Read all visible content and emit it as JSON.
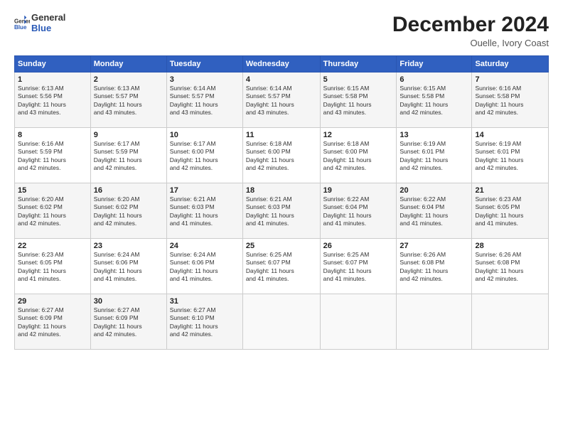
{
  "logo": {
    "line1": "General",
    "line2": "Blue"
  },
  "title": "December 2024",
  "subtitle": "Ouelle, Ivory Coast",
  "days_of_week": [
    "Sunday",
    "Monday",
    "Tuesday",
    "Wednesday",
    "Thursday",
    "Friday",
    "Saturday"
  ],
  "weeks": [
    [
      {
        "day": "1",
        "info": "Sunrise: 6:13 AM\nSunset: 5:56 PM\nDaylight: 11 hours\nand 43 minutes."
      },
      {
        "day": "2",
        "info": "Sunrise: 6:13 AM\nSunset: 5:57 PM\nDaylight: 11 hours\nand 43 minutes."
      },
      {
        "day": "3",
        "info": "Sunrise: 6:14 AM\nSunset: 5:57 PM\nDaylight: 11 hours\nand 43 minutes."
      },
      {
        "day": "4",
        "info": "Sunrise: 6:14 AM\nSunset: 5:57 PM\nDaylight: 11 hours\nand 43 minutes."
      },
      {
        "day": "5",
        "info": "Sunrise: 6:15 AM\nSunset: 5:58 PM\nDaylight: 11 hours\nand 43 minutes."
      },
      {
        "day": "6",
        "info": "Sunrise: 6:15 AM\nSunset: 5:58 PM\nDaylight: 11 hours\nand 42 minutes."
      },
      {
        "day": "7",
        "info": "Sunrise: 6:16 AM\nSunset: 5:58 PM\nDaylight: 11 hours\nand 42 minutes."
      }
    ],
    [
      {
        "day": "8",
        "info": "Sunrise: 6:16 AM\nSunset: 5:59 PM\nDaylight: 11 hours\nand 42 minutes."
      },
      {
        "day": "9",
        "info": "Sunrise: 6:17 AM\nSunset: 5:59 PM\nDaylight: 11 hours\nand 42 minutes."
      },
      {
        "day": "10",
        "info": "Sunrise: 6:17 AM\nSunset: 6:00 PM\nDaylight: 11 hours\nand 42 minutes."
      },
      {
        "day": "11",
        "info": "Sunrise: 6:18 AM\nSunset: 6:00 PM\nDaylight: 11 hours\nand 42 minutes."
      },
      {
        "day": "12",
        "info": "Sunrise: 6:18 AM\nSunset: 6:00 PM\nDaylight: 11 hours\nand 42 minutes."
      },
      {
        "day": "13",
        "info": "Sunrise: 6:19 AM\nSunset: 6:01 PM\nDaylight: 11 hours\nand 42 minutes."
      },
      {
        "day": "14",
        "info": "Sunrise: 6:19 AM\nSunset: 6:01 PM\nDaylight: 11 hours\nand 42 minutes."
      }
    ],
    [
      {
        "day": "15",
        "info": "Sunrise: 6:20 AM\nSunset: 6:02 PM\nDaylight: 11 hours\nand 42 minutes."
      },
      {
        "day": "16",
        "info": "Sunrise: 6:20 AM\nSunset: 6:02 PM\nDaylight: 11 hours\nand 42 minutes."
      },
      {
        "day": "17",
        "info": "Sunrise: 6:21 AM\nSunset: 6:03 PM\nDaylight: 11 hours\nand 41 minutes."
      },
      {
        "day": "18",
        "info": "Sunrise: 6:21 AM\nSunset: 6:03 PM\nDaylight: 11 hours\nand 41 minutes."
      },
      {
        "day": "19",
        "info": "Sunrise: 6:22 AM\nSunset: 6:04 PM\nDaylight: 11 hours\nand 41 minutes."
      },
      {
        "day": "20",
        "info": "Sunrise: 6:22 AM\nSunset: 6:04 PM\nDaylight: 11 hours\nand 41 minutes."
      },
      {
        "day": "21",
        "info": "Sunrise: 6:23 AM\nSunset: 6:05 PM\nDaylight: 11 hours\nand 41 minutes."
      }
    ],
    [
      {
        "day": "22",
        "info": "Sunrise: 6:23 AM\nSunset: 6:05 PM\nDaylight: 11 hours\nand 41 minutes."
      },
      {
        "day": "23",
        "info": "Sunrise: 6:24 AM\nSunset: 6:06 PM\nDaylight: 11 hours\nand 41 minutes."
      },
      {
        "day": "24",
        "info": "Sunrise: 6:24 AM\nSunset: 6:06 PM\nDaylight: 11 hours\nand 41 minutes."
      },
      {
        "day": "25",
        "info": "Sunrise: 6:25 AM\nSunset: 6:07 PM\nDaylight: 11 hours\nand 41 minutes."
      },
      {
        "day": "26",
        "info": "Sunrise: 6:25 AM\nSunset: 6:07 PM\nDaylight: 11 hours\nand 41 minutes."
      },
      {
        "day": "27",
        "info": "Sunrise: 6:26 AM\nSunset: 6:08 PM\nDaylight: 11 hours\nand 42 minutes."
      },
      {
        "day": "28",
        "info": "Sunrise: 6:26 AM\nSunset: 6:08 PM\nDaylight: 11 hours\nand 42 minutes."
      }
    ],
    [
      {
        "day": "29",
        "info": "Sunrise: 6:27 AM\nSunset: 6:09 PM\nDaylight: 11 hours\nand 42 minutes."
      },
      {
        "day": "30",
        "info": "Sunrise: 6:27 AM\nSunset: 6:09 PM\nDaylight: 11 hours\nand 42 minutes."
      },
      {
        "day": "31",
        "info": "Sunrise: 6:27 AM\nSunset: 6:10 PM\nDaylight: 11 hours\nand 42 minutes."
      },
      null,
      null,
      null,
      null
    ]
  ]
}
